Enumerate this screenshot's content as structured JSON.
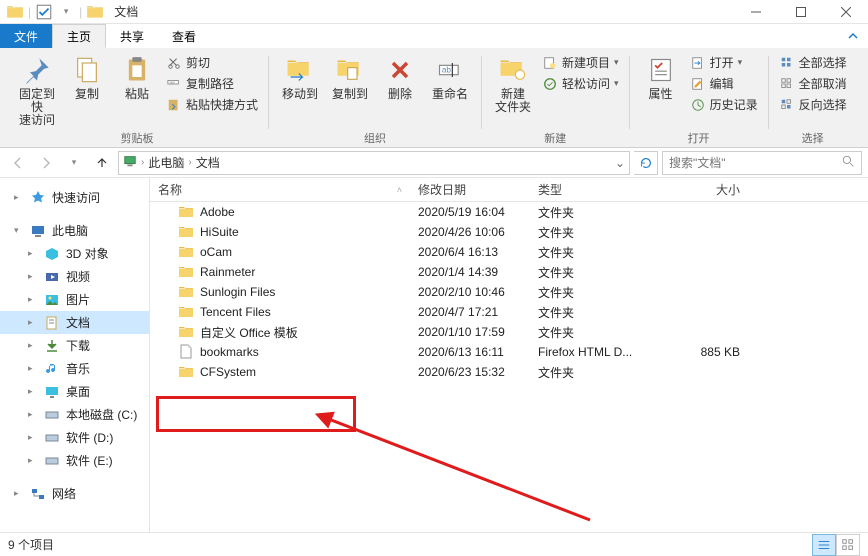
{
  "window": {
    "title": "文档"
  },
  "tabs": {
    "file": "文件",
    "home": "主页",
    "share": "共享",
    "view": "查看"
  },
  "ribbon": {
    "pin": "固定到快\n速访问",
    "copy": "复制",
    "paste": "粘贴",
    "cut": "剪切",
    "copy_path": "复制路径",
    "paste_shortcut": "粘贴快捷方式",
    "group_clipboard": "剪贴板",
    "move_to": "移动到",
    "copy_to": "复制到",
    "delete": "删除",
    "rename": "重命名",
    "group_organize": "组织",
    "new_folder": "新建\n文件夹",
    "new_item": "新建项目",
    "easy_access": "轻松访问",
    "group_new": "新建",
    "properties": "属性",
    "open": "打开",
    "edit": "编辑",
    "history": "历史记录",
    "group_open": "打开",
    "select_all": "全部选择",
    "select_none": "全部取消",
    "invert_selection": "反向选择",
    "group_select": "选择"
  },
  "address": {
    "root": "此电脑",
    "current": "文档"
  },
  "search": {
    "placeholder": "搜索\"文档\""
  },
  "nav": {
    "quick_access": "快速访问",
    "this_pc": "此电脑",
    "objects3d": "3D 对象",
    "videos": "视频",
    "pictures": "图片",
    "documents": "文档",
    "downloads": "下载",
    "music": "音乐",
    "desktop": "桌面",
    "disk_c": "本地磁盘 (C:)",
    "disk_d": "软件 (D:)",
    "disk_e": "软件 (E:)",
    "network": "网络"
  },
  "columns": {
    "name": "名称",
    "date": "修改日期",
    "type": "类型",
    "size": "大小"
  },
  "types": {
    "folder": "文件夹",
    "firefox_html": "Firefox HTML D..."
  },
  "items": [
    {
      "name": "Adobe",
      "date": "2020/5/19 16:04",
      "type": "folder",
      "size": ""
    },
    {
      "name": "HiSuite",
      "date": "2020/4/26 10:06",
      "type": "folder",
      "size": ""
    },
    {
      "name": "oCam",
      "date": "2020/6/4 16:13",
      "type": "folder",
      "size": ""
    },
    {
      "name": "Rainmeter",
      "date": "2020/1/4 14:39",
      "type": "folder",
      "size": ""
    },
    {
      "name": "Sunlogin Files",
      "date": "2020/2/10 10:46",
      "type": "folder",
      "size": ""
    },
    {
      "name": "Tencent Files",
      "date": "2020/4/7 17:21",
      "type": "folder",
      "size": ""
    },
    {
      "name": "自定义 Office 模板",
      "date": "2020/1/10 17:59",
      "type": "folder",
      "size": ""
    },
    {
      "name": "bookmarks",
      "date": "2020/6/13 16:11",
      "type": "firefox_html",
      "size": "885 KB"
    },
    {
      "name": "CFSystem",
      "date": "2020/6/23 15:32",
      "type": "folder",
      "size": ""
    }
  ],
  "status": {
    "count": "9 个项目"
  }
}
